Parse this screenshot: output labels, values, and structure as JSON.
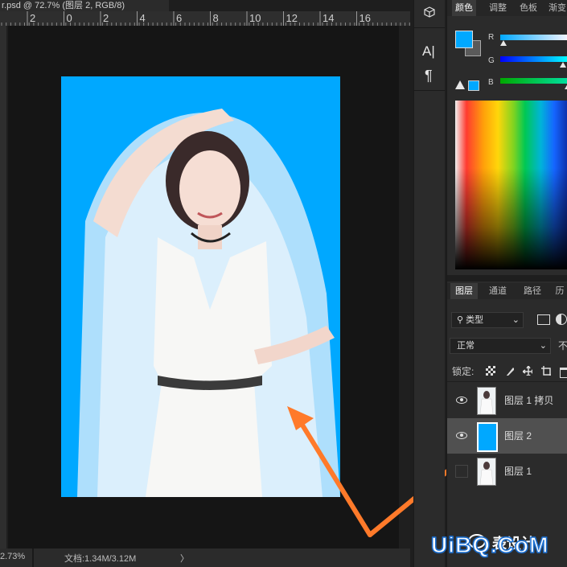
{
  "document": {
    "tab_title": "r.psd @ 72.7% (图层 2, RGB/8)",
    "ruler_ticks": [
      "2",
      "0",
      "2",
      "4",
      "6",
      "8",
      "10",
      "12",
      "14",
      "16"
    ]
  },
  "status": {
    "zoom": "2.73%",
    "doc_info": "文档:1.34M/3.12M",
    "arrow": "〉"
  },
  "toolstrip": {
    "char_label": "A|",
    "para_label": "¶"
  },
  "color_panel": {
    "tabs": [
      "颜色",
      "调整",
      "色板",
      "渐变"
    ],
    "active_tab": 0,
    "foreground": "#00a8ff",
    "background": "#5a5a5a",
    "channels": [
      {
        "label": "R",
        "value": 0.0
      },
      {
        "label": "G",
        "value": 0.93
      },
      {
        "label": "B",
        "value": 1.0
      }
    ]
  },
  "layers_panel": {
    "tabs": [
      "图层",
      "通道",
      "路径",
      "历"
    ],
    "active_tab": 0,
    "filter_label": "类型",
    "blend_mode": "正常",
    "opacity_label": "不",
    "lock_label": "锁定:",
    "layers": [
      {
        "name": "图层 1 拷贝",
        "visible": true,
        "selected": false,
        "thumb": "photo"
      },
      {
        "name": "图层 2",
        "visible": true,
        "selected": true,
        "thumb": "#00a8ff"
      },
      {
        "name": "图层 1",
        "visible": false,
        "selected": false,
        "thumb": "photo"
      }
    ]
  },
  "watermark": {
    "site": "UiBQ.CoM",
    "partial": "表设计"
  },
  "accent": "#ff7a2a"
}
